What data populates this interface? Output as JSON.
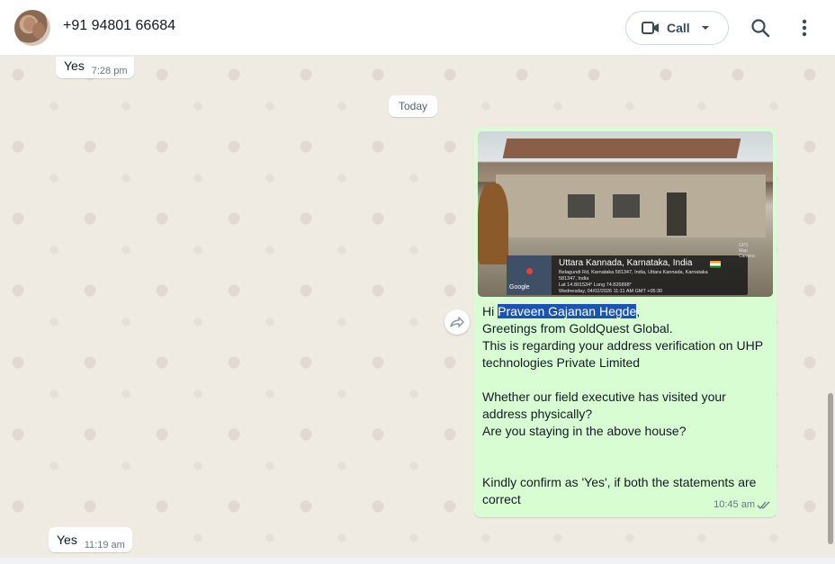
{
  "header": {
    "contact_name": "+91 94801 66684",
    "call_label": "Call",
    "icons": [
      "video-camera-icon",
      "chevron-down-icon",
      "search-icon",
      "more-vertical-icon"
    ]
  },
  "messages": {
    "earlier_reply": {
      "text": "Yes",
      "time": "7:28 pm"
    },
    "date_separator": "Today",
    "outgoing": {
      "photo": {
        "location_title": "Uttara Kannada, Karnataka, India",
        "address_line1": "Belagundi Rd, Karnataka 581347, India, Uttara Kannada, Karnataka",
        "address_line2": "581347, India",
        "coords": "Lat 14.801534° Long 74.826898°",
        "datetime": "Wednesday, 04/02/2026 11:11 AM GMT +05:30",
        "map_label": "Google",
        "camera_brand": "GPS Map Camera"
      },
      "greeting_prefix": "Hi ",
      "highlighted_name": "Praveen Gajanan Hegde",
      "greeting_suffix": ",",
      "lines": [
        "Greetings from GoldQuest Global.",
        "This is regarding your address verification on UHP technologies Private Limited",
        "",
        "Whether our field executive has visited your address physically?",
        "Are you staying in the above house?",
        "",
        "",
        "Kindly confirm as 'Yes', if both the statements are correct"
      ],
      "time": "10:45 am",
      "status_icon": "double-check-icon"
    },
    "latest_reply": {
      "text": "Yes",
      "time": "11:19 am"
    }
  },
  "colors": {
    "outgoing_bubble": "#d9fdd3",
    "incoming_bubble": "#ffffff",
    "chat_background": "#efeae2",
    "selection_highlight": "#1b53b5"
  }
}
